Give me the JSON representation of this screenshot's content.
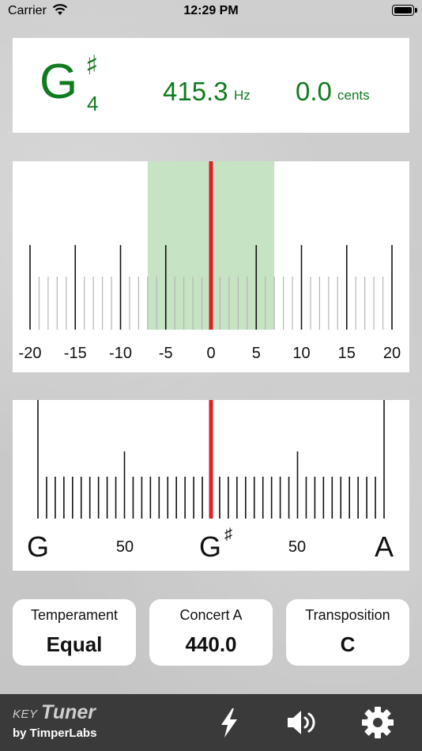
{
  "status_bar": {
    "carrier": "Carrier",
    "time": "12:29 PM"
  },
  "note": {
    "letter": "G",
    "accidental": "♯",
    "octave": "4"
  },
  "frequency": {
    "value": "415.3",
    "unit": "Hz"
  },
  "cents": {
    "value": "0.0",
    "unit": "cents"
  },
  "fine_scale": {
    "labels": [
      "-20",
      "-15",
      "-10",
      "-5",
      "0",
      "5",
      "10",
      "15",
      "20"
    ],
    "tolerance_band_cents": [
      -7,
      7
    ],
    "needle_cents": 0
  },
  "coarse_scale": {
    "left_note": "G",
    "center_note": "G",
    "center_accidental": "♯",
    "right_note": "A",
    "left_mid_label": "50",
    "right_mid_label": "50",
    "needle_position": 0
  },
  "settings": {
    "temperament": {
      "label": "Temperament",
      "value": "Equal"
    },
    "concert_a": {
      "label": "Concert A",
      "value": "440.0"
    },
    "transposition": {
      "label": "Transposition",
      "value": "C"
    }
  },
  "toolbar": {
    "logo_key": "KEY",
    "logo_tuner": "Tuner",
    "logo_by": "by TimperLabs"
  },
  "colors": {
    "note_green": "#0f7a1e",
    "needle_red": "#e02020",
    "band_green": "#c6e3c3",
    "toolbar_bg": "#3a3a3a"
  },
  "icons": [
    "wifi-icon",
    "battery-icon",
    "lightning-icon",
    "speaker-icon",
    "gear-icon"
  ]
}
